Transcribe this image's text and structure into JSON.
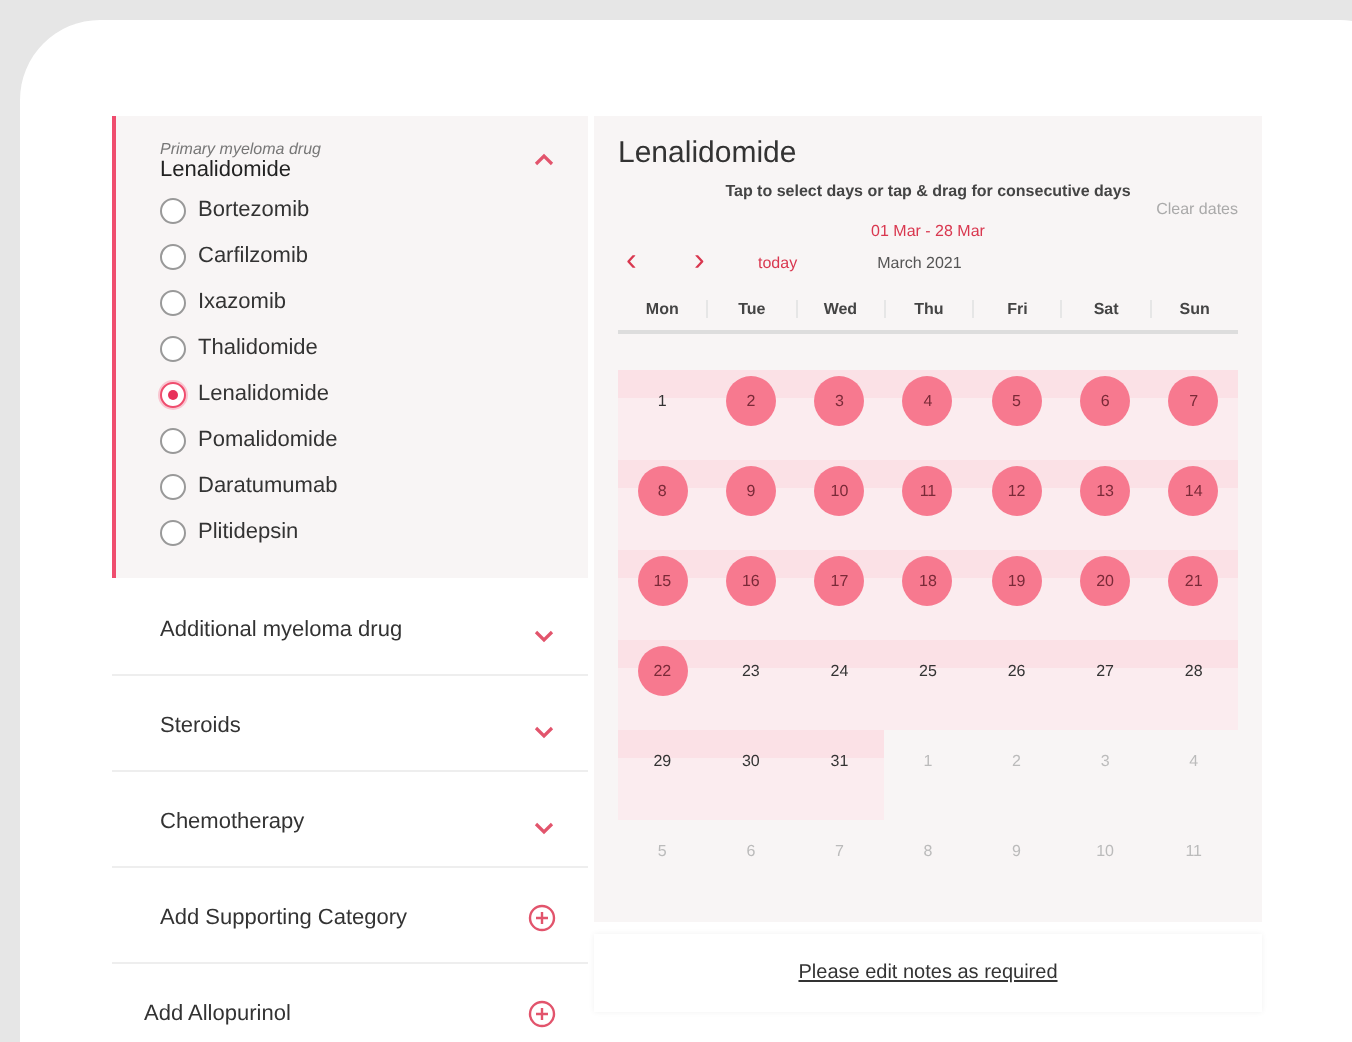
{
  "primary": {
    "caption": "Primary myeloma drug",
    "value": "Lenalidomide",
    "expanded": true,
    "options": [
      {
        "label": "Bortezomib",
        "selected": false
      },
      {
        "label": "Carfilzomib",
        "selected": false
      },
      {
        "label": "Ixazomib",
        "selected": false
      },
      {
        "label": "Thalidomide",
        "selected": false
      },
      {
        "label": "Lenalidomide",
        "selected": true
      },
      {
        "label": "Pomalidomide",
        "selected": false
      },
      {
        "label": "Daratumumab",
        "selected": false
      },
      {
        "label": "Plitidepsin",
        "selected": false
      }
    ]
  },
  "categories": [
    {
      "label": "Additional myeloma drug",
      "kind": "dropdown"
    },
    {
      "label": "Steroids",
      "kind": "dropdown"
    },
    {
      "label": "Chemotherapy",
      "kind": "dropdown"
    },
    {
      "label": "Add Supporting Category",
      "kind": "add"
    },
    {
      "label": "Add Allopurinol",
      "kind": "add"
    }
  ],
  "calendar": {
    "title": "Lenalidomide",
    "instruction": "Tap to select days or tap & drag for consecutive days",
    "clear": "Clear dates",
    "range": "01 Mar - 28 Mar",
    "prev": "‹",
    "next": "›",
    "today": "today",
    "month": "March 2021",
    "weekdays": [
      "Mon",
      "Tue",
      "Wed",
      "Thu",
      "Fri",
      "Sat",
      "Sun"
    ],
    "weeks": [
      [
        {
          "label": "1",
          "in_month": true,
          "selected": false
        },
        {
          "label": "2",
          "in_month": true,
          "selected": true
        },
        {
          "label": "3",
          "in_month": true,
          "selected": true
        },
        {
          "label": "4",
          "in_month": true,
          "selected": true
        },
        {
          "label": "5",
          "in_month": true,
          "selected": true
        },
        {
          "label": "6",
          "in_month": true,
          "selected": true
        },
        {
          "label": "7",
          "in_month": true,
          "selected": true
        }
      ],
      [
        {
          "label": "8",
          "in_month": true,
          "selected": true
        },
        {
          "label": "9",
          "in_month": true,
          "selected": true
        },
        {
          "label": "10",
          "in_month": true,
          "selected": true
        },
        {
          "label": "11",
          "in_month": true,
          "selected": true
        },
        {
          "label": "12",
          "in_month": true,
          "selected": true
        },
        {
          "label": "13",
          "in_month": true,
          "selected": true
        },
        {
          "label": "14",
          "in_month": true,
          "selected": true
        }
      ],
      [
        {
          "label": "15",
          "in_month": true,
          "selected": true
        },
        {
          "label": "16",
          "in_month": true,
          "selected": true
        },
        {
          "label": "17",
          "in_month": true,
          "selected": true
        },
        {
          "label": "18",
          "in_month": true,
          "selected": true
        },
        {
          "label": "19",
          "in_month": true,
          "selected": true
        },
        {
          "label": "20",
          "in_month": true,
          "selected": true
        },
        {
          "label": "21",
          "in_month": true,
          "selected": true
        }
      ],
      [
        {
          "label": "22",
          "in_month": true,
          "selected": true
        },
        {
          "label": "23",
          "in_month": true,
          "selected": false
        },
        {
          "label": "24",
          "in_month": true,
          "selected": false
        },
        {
          "label": "25",
          "in_month": true,
          "selected": false
        },
        {
          "label": "26",
          "in_month": true,
          "selected": false
        },
        {
          "label": "27",
          "in_month": true,
          "selected": false
        },
        {
          "label": "28",
          "in_month": true,
          "selected": false
        }
      ],
      [
        {
          "label": "29",
          "in_month": true,
          "selected": false
        },
        {
          "label": "30",
          "in_month": true,
          "selected": false
        },
        {
          "label": "31",
          "in_month": true,
          "selected": false
        },
        {
          "label": "1",
          "in_month": false,
          "selected": false
        },
        {
          "label": "2",
          "in_month": false,
          "selected": false
        },
        {
          "label": "3",
          "in_month": false,
          "selected": false
        },
        {
          "label": "4",
          "in_month": false,
          "selected": false
        }
      ],
      [
        {
          "label": "5",
          "in_month": false,
          "selected": false
        },
        {
          "label": "6",
          "in_month": false,
          "selected": false
        },
        {
          "label": "7",
          "in_month": false,
          "selected": false
        },
        {
          "label": "8",
          "in_month": false,
          "selected": false
        },
        {
          "label": "9",
          "in_month": false,
          "selected": false
        },
        {
          "label": "10",
          "in_month": false,
          "selected": false
        },
        {
          "label": "11",
          "in_month": false,
          "selected": false
        }
      ]
    ]
  },
  "notes": {
    "link": "Please edit notes as required"
  }
}
